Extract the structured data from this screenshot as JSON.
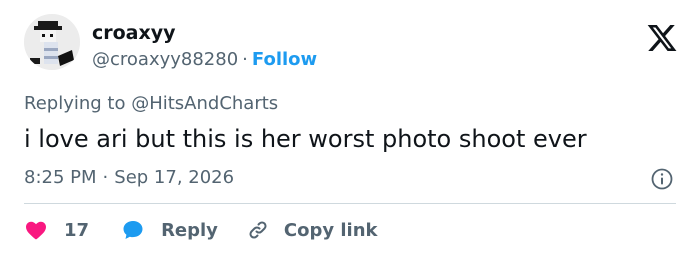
{
  "user": {
    "display_name": "croaxyy",
    "handle": "@croaxyy88280",
    "follow_label": "Follow",
    "separator": "·"
  },
  "brand_icon": "x-logo-icon",
  "reply_context": {
    "prefix": "Replying to ",
    "mention": "@HitsAndCharts"
  },
  "tweet": {
    "text": "i love ari but this is her worst photo shoot ever",
    "time": "8:25 PM",
    "separator": "·",
    "date": "Sep 17, 2026"
  },
  "actions": {
    "like_count": "17",
    "reply_label": "Reply",
    "copy_link_label": "Copy link"
  },
  "colors": {
    "text": "#0f1419",
    "secondary": "#536471",
    "accent": "#1d9bf0",
    "like": "#f91880",
    "divider": "#cfd9de"
  },
  "icons": {
    "info": "info-icon",
    "like": "heart-icon",
    "reply": "speech-bubble-icon",
    "copy": "link-icon"
  }
}
